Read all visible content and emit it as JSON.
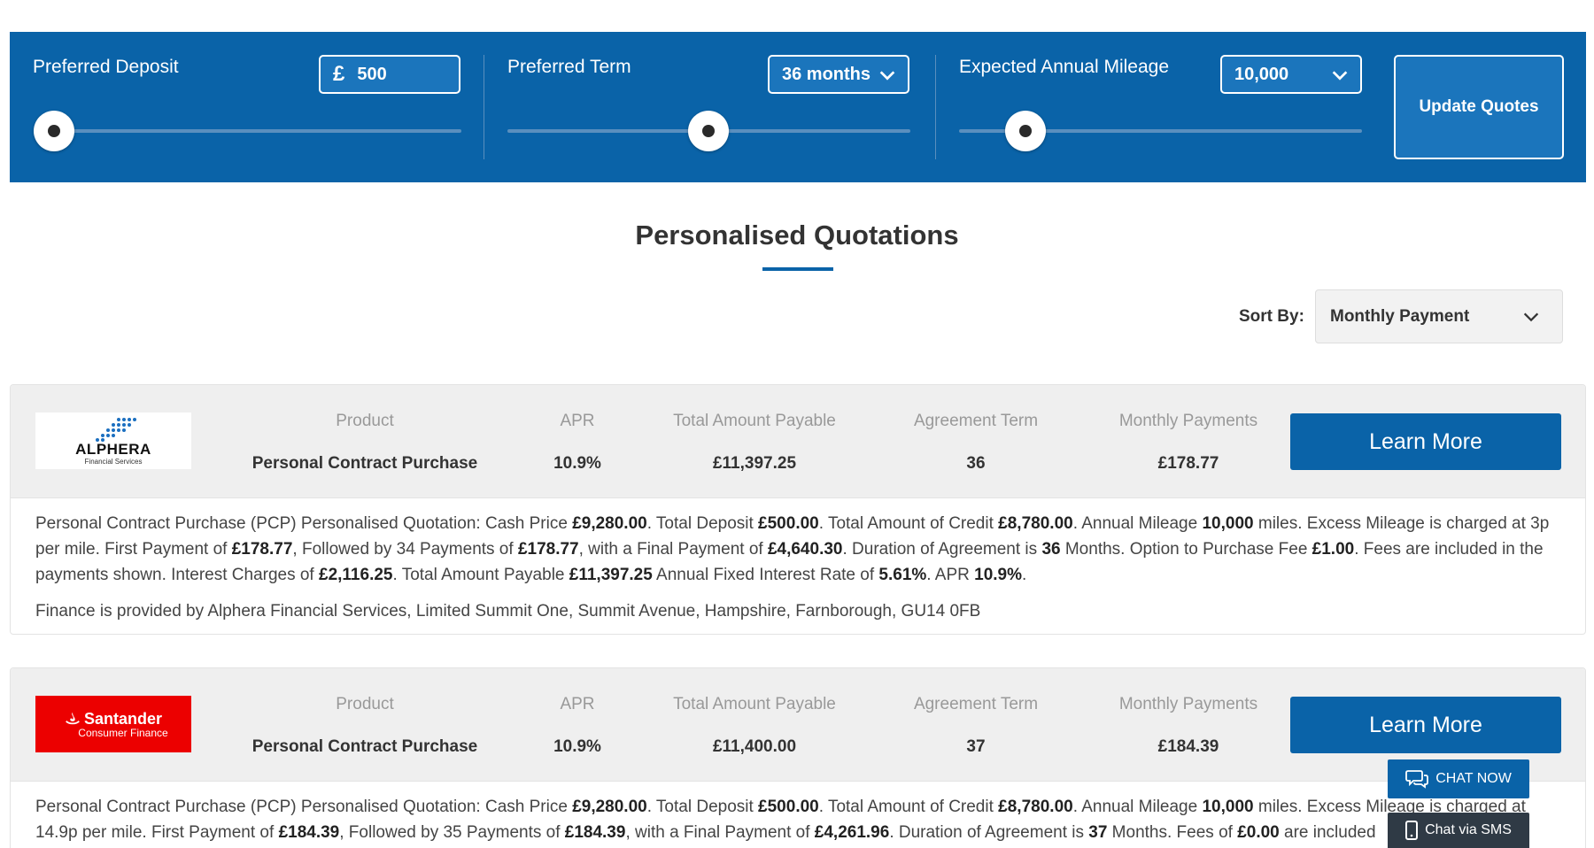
{
  "filters": {
    "deposit": {
      "label": "Preferred Deposit",
      "currency_symbol": "£",
      "value": "500",
      "slider_fraction": 0.0
    },
    "term": {
      "label": "Preferred Term",
      "value": "36 months",
      "slider_fraction": 0.5
    },
    "mileage": {
      "label": "Expected Annual Mileage",
      "value": "10,000",
      "slider_fraction": 0.1
    },
    "update_button": "Update Quotes"
  },
  "page_title": "Personalised Quotations",
  "sort": {
    "label": "Sort By:",
    "value": "Monthly Payment"
  },
  "columns": {
    "product": "Product",
    "apr": "APR",
    "total": "Total Amount Payable",
    "term": "Agreement Term",
    "monthly": "Monthly Payments"
  },
  "learn_more_label": "Learn More",
  "quotes": [
    {
      "logo": {
        "brand": "ALPHERA",
        "sub": "Financial Services",
        "color": "#ffffff"
      },
      "product": "Personal Contract Purchase",
      "apr": "10.9%",
      "total": "£11,397.25",
      "term": "36",
      "monthly": "£178.77",
      "desc": [
        "Personal Contract Purchase (PCP) Personalised Quotation: Cash Price ",
        "£9,280.00",
        ". Total Deposit ",
        "£500.00",
        ". Total Amount of Credit ",
        "£8,780.00",
        ". Annual Mileage ",
        "10,000",
        " miles. Excess Mileage is charged at 3p per mile. First Payment of ",
        "£178.77",
        ", Followed by 34 Payments of ",
        "£178.77",
        ", with a Final Payment of ",
        "£4,640.30",
        ". Duration of Agreement is ",
        "36",
        " Months. Option to Purchase Fee ",
        "£1.00",
        ". Fees are included in the payments shown. Interest Charges of ",
        "£2,116.25",
        ". Total Amount Payable ",
        "£11,397.25",
        " Annual Fixed Interest Rate of ",
        "5.61%",
        ". APR ",
        "10.9%",
        "."
      ],
      "provider": "Finance is provided by Alphera Financial Services, Limited Summit One, Summit Avenue, Hampshire, Farnborough, GU14 0FB"
    },
    {
      "logo": {
        "brand": "Santander",
        "sub": "Consumer Finance",
        "color": "#ec0000"
      },
      "product": "Personal Contract Purchase",
      "apr": "10.9%",
      "total": "£11,400.00",
      "term": "37",
      "monthly": "£184.39",
      "desc": [
        "Personal Contract Purchase (PCP) Personalised Quotation: Cash Price ",
        "£9,280.00",
        ". Total Deposit ",
        "£500.00",
        ". Total Amount of Credit ",
        "£8,780.00",
        ". Annual Mileage ",
        "10,000",
        " miles. Excess Mileage is charged at 14.9p per mile. First Payment of ",
        "£184.39",
        ", Followed by 35 Payments of ",
        "£184.39",
        ", with a Final Payment of ",
        "£4,261.96",
        ". Duration of Agreement is ",
        "37",
        " Months. Fees of ",
        "£0.00",
        " are included"
      ]
    }
  ],
  "chat": {
    "now_label": "CHAT NOW",
    "sms_label": "Chat via SMS"
  },
  "colors": {
    "primary": "#0a63a8",
    "santander_red": "#ec0000"
  }
}
